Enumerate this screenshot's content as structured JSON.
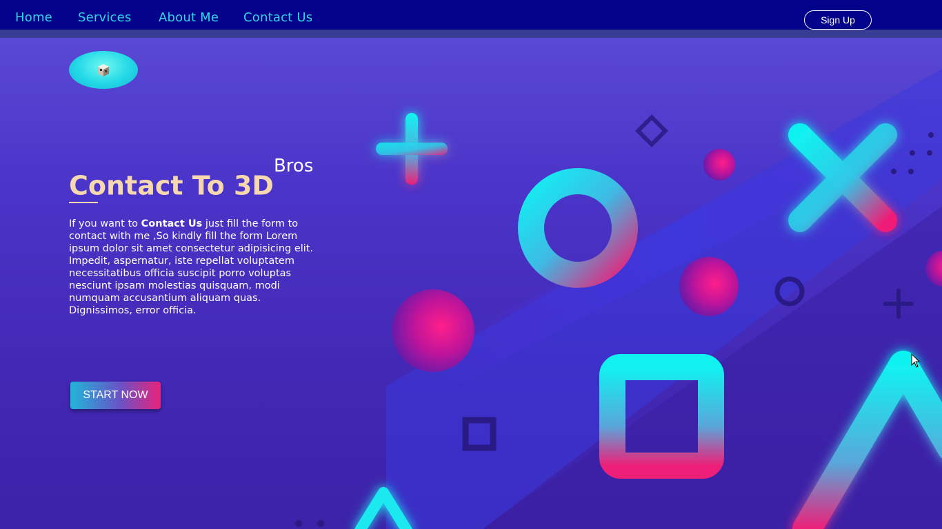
{
  "nav": {
    "links": [
      "Home",
      "Services",
      "About Me",
      "Contact Us"
    ],
    "signup_label": "Sign Up"
  },
  "hero": {
    "title_main": "Contact To 3D",
    "title_sup": "Bros",
    "desc_prefix": "If you want to ",
    "desc_bold": "Contact Us",
    "desc_rest": " just fill the form to contact with me ,So kindly fill the form Lorem ipsum dolor sit amet consectetur adipisicing elit. Impedit, aspernatur, iste repellat voluptatem necessitatibus officia suscipit porro voluptas nesciunt ipsam molestias quisquam, modi numquam accusantium aliquam quas. Dignissimos, error officia.",
    "cta_label": "START NOW"
  },
  "icons": {
    "logo": "cube-logo-icon",
    "decor": [
      "plus-shape",
      "ring-shape",
      "x-shape",
      "square-shape",
      "triangle-shape",
      "sphere-shape",
      "diamond-shape"
    ]
  },
  "colors": {
    "nav_bg": "#02038a",
    "nav_link": "#34d6e6",
    "title": "#f5d7b0",
    "cyan": "#1ee8f0",
    "magenta": "#e8237a"
  }
}
